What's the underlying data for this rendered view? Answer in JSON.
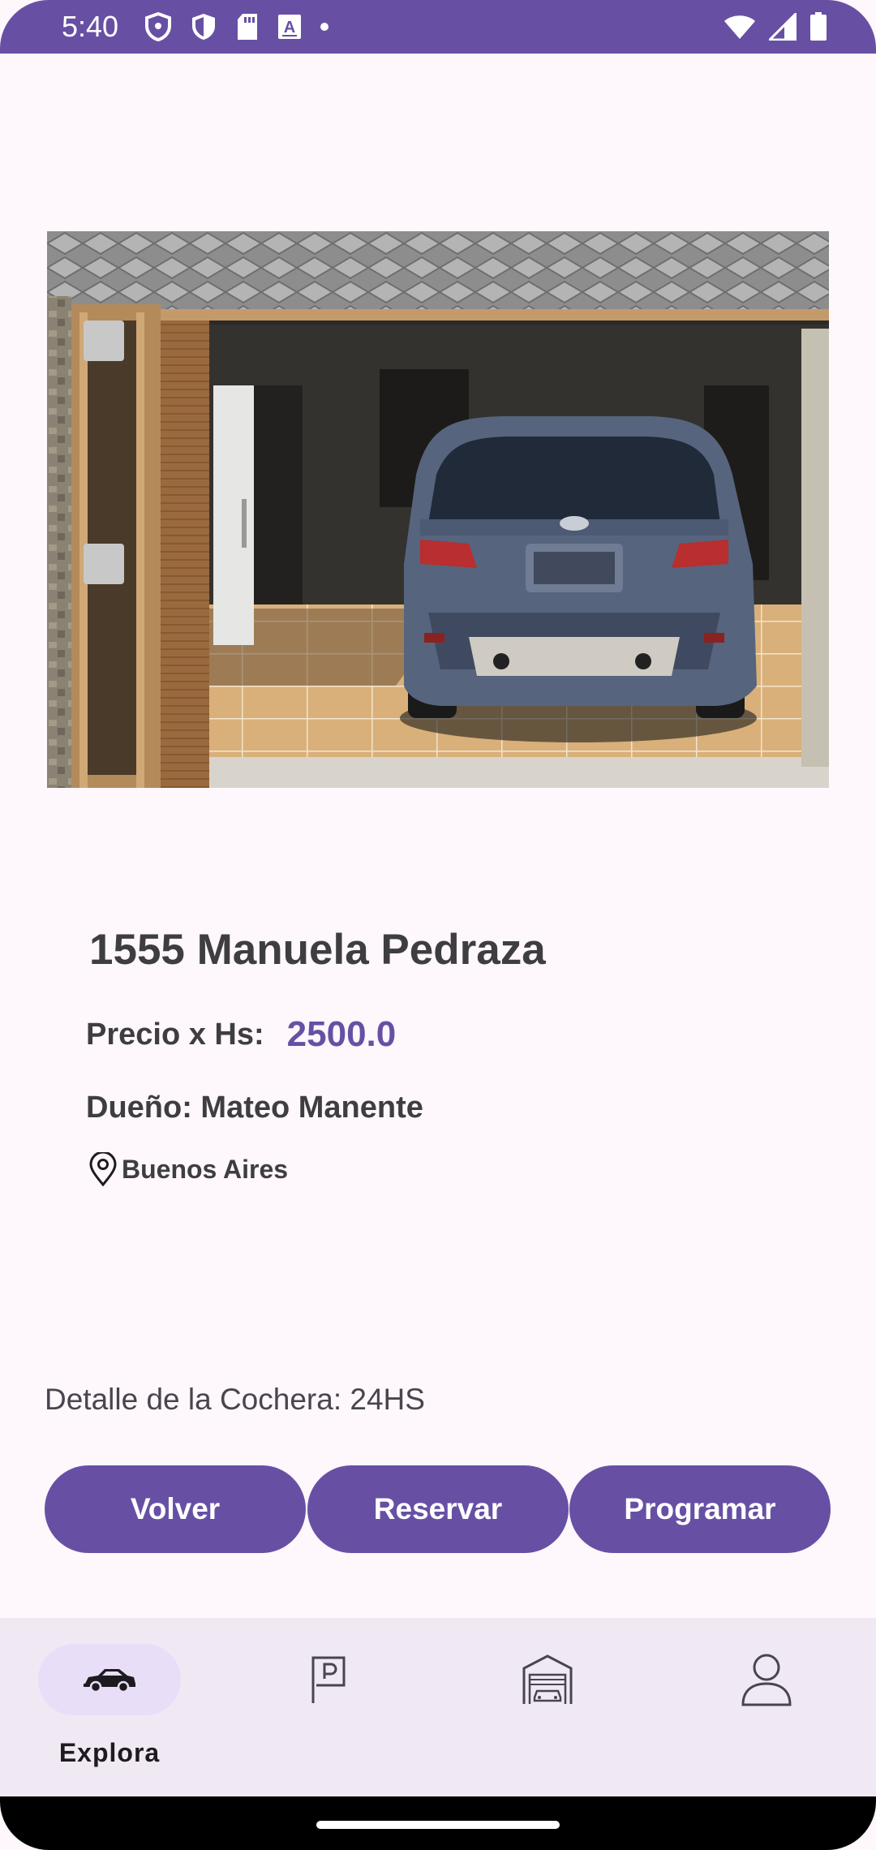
{
  "status_bar": {
    "time": "5:40",
    "icons_left": [
      "privacy-shield-icon",
      "security-shield-icon",
      "sd-card-icon",
      "text-a-icon",
      "dot-icon"
    ],
    "icons_right": [
      "wifi-icon",
      "cell-signal-icon",
      "battery-icon"
    ]
  },
  "listing": {
    "photo": "garage-with-car-photo",
    "title": "1555 Manuela Pedraza",
    "price_label": "Precio x Hs:",
    "price_value": "2500.0",
    "owner": "Dueño: Mateo Manente",
    "location": "Buenos Aires",
    "detail": "Detalle de la Cochera: 24HS"
  },
  "actions": {
    "back": "Volver",
    "reserve": "Reservar",
    "schedule": "Programar"
  },
  "bottom_nav": {
    "items": [
      {
        "label": "Explora",
        "icon": "car-icon",
        "selected": true
      },
      {
        "label": "",
        "icon": "parking-sign-icon",
        "selected": false
      },
      {
        "label": "",
        "icon": "garage-icon",
        "selected": false
      },
      {
        "label": "",
        "icon": "profile-icon",
        "selected": false
      }
    ]
  },
  "colors": {
    "primary": "#6750a4",
    "background": "#fef7fb",
    "nav_background": "#f0e9f4",
    "nav_indicator": "#e8def8",
    "text": "#3e3e42"
  }
}
